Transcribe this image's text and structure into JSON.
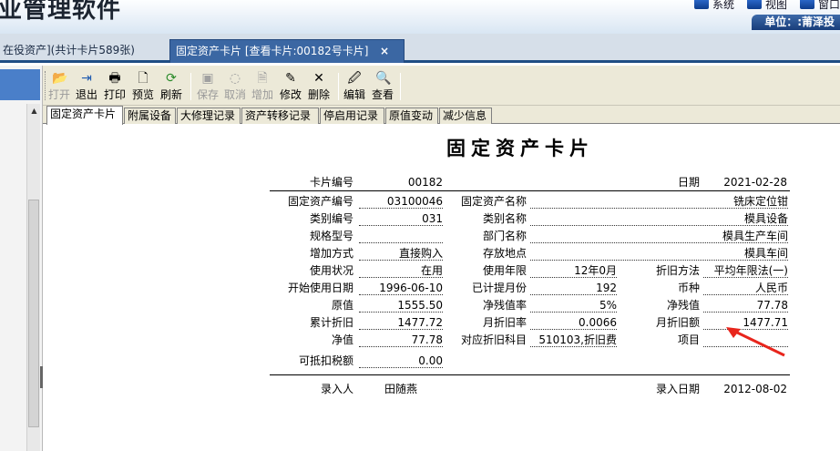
{
  "app": {
    "title": "业管理软件"
  },
  "top_menu": [
    {
      "label": "系统",
      "icon": "system-icon"
    },
    {
      "label": "视图",
      "icon": "view-icon"
    },
    {
      "label": "窗口",
      "icon": "window-icon"
    }
  ],
  "unit_label": "单位：:莆泽投",
  "open_tabs": [
    {
      "label": "在役资产](共计卡片589张)"
    },
    {
      "label": "固定资产卡片 [查看卡片:00182号卡片]",
      "close": "×"
    }
  ],
  "toolbar": [
    {
      "label": "打开",
      "icon": "open-folder-icon",
      "enabled": false
    },
    {
      "label": "退出",
      "icon": "exit-icon",
      "enabled": true
    },
    {
      "label": "打印",
      "icon": "print-icon",
      "enabled": true
    },
    {
      "label": "预览",
      "icon": "preview-icon",
      "enabled": true
    },
    {
      "label": "刷新",
      "icon": "refresh-icon",
      "enabled": true
    },
    {
      "label": "保存",
      "icon": "save-icon",
      "enabled": false
    },
    {
      "label": "取消",
      "icon": "cancel-icon",
      "enabled": false
    },
    {
      "label": "增加",
      "icon": "add-icon",
      "enabled": false
    },
    {
      "label": "修改",
      "icon": "edit-icon",
      "enabled": true
    },
    {
      "label": "删除",
      "icon": "delete-icon",
      "enabled": true
    },
    {
      "label": "编辑",
      "icon": "editor-icon",
      "enabled": true
    },
    {
      "label": "查看",
      "icon": "view-icon",
      "enabled": true
    }
  ],
  "sub_tabs": [
    "固定资产卡片",
    "附属设备",
    "大修理记录",
    "资产转移记录",
    "停启用记录",
    "原值变动",
    "减少信息"
  ],
  "card": {
    "title": "固定资产卡片",
    "card_no_label": "卡片编号",
    "card_no": "00182",
    "date_label": "日期",
    "date": "2021-02-28",
    "asset_code_label": "固定资产编号",
    "asset_code": "03100046",
    "asset_name_label": "固定资产名称",
    "asset_name": "铣床定位钳",
    "category_code_label": "类别编号",
    "category_code": "031",
    "category_name_label": "类别名称",
    "category_name": "模具设备",
    "spec_label": "规格型号",
    "spec": "",
    "department_label": "部门名称",
    "department": "模具生产车间",
    "add_method_label": "增加方式",
    "add_method": "直接购入",
    "location_label": "存放地点",
    "location": "模具车间",
    "status_label": "使用状况",
    "status": "在用",
    "life_label": "使用年限",
    "life": "12年0月",
    "depr_method_label": "折旧方法",
    "depr_method": "平均年限法(一)",
    "start_date_label": "开始使用日期",
    "start_date": "1996-06-10",
    "months_label": "已计提月份",
    "months": "192",
    "currency_label": "币种",
    "currency": "人民币",
    "original_label": "原值",
    "original": "1555.50",
    "salvage_rate_label": "净残值率",
    "salvage_rate": "5%",
    "salvage_label": "净残值",
    "salvage": "77.78",
    "accum_label": "累计折旧",
    "accum": "1477.72",
    "monthly_rate_label": "月折旧率",
    "monthly_rate": "0.0066",
    "monthly_amt_label": "月折旧额",
    "monthly_amt": "1477.71",
    "net_label": "净值",
    "net": "77.78",
    "account_label": "对应折旧科目",
    "account": "510103,折旧费",
    "project_label": "项目",
    "project": "",
    "tax_label": "可抵扣税额",
    "tax": "0.00",
    "entered_by_label": "录入人",
    "entered_by": "田随燕",
    "entered_date_label": "录入日期",
    "entered_date": "2012-08-02"
  },
  "annotation_color": "#e8251c"
}
